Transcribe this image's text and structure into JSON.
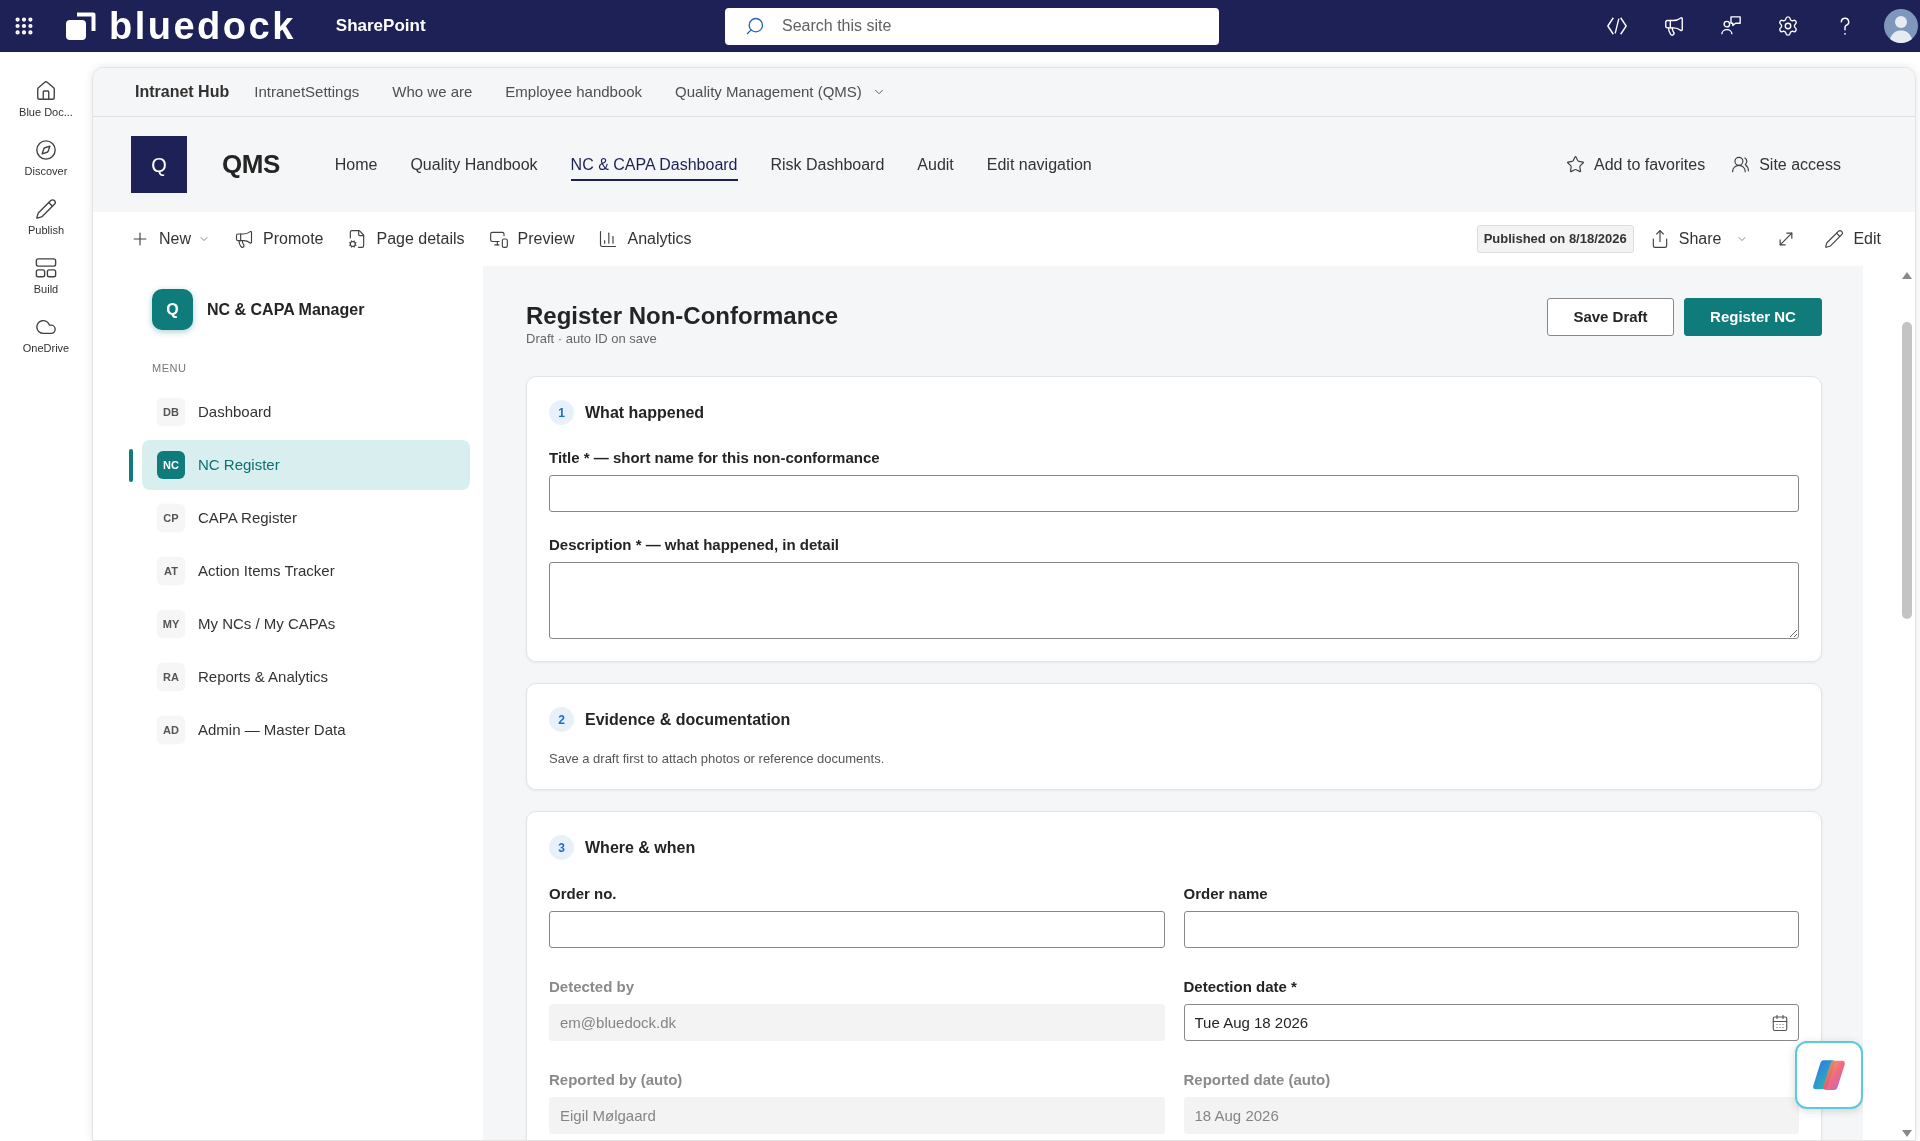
{
  "suite_bar": {
    "brand": "bluedock",
    "app": "SharePoint",
    "search": {
      "placeholder": "Search this site"
    }
  },
  "app_rail": [
    {
      "label": "Blue Doc..."
    },
    {
      "label": "Discover"
    },
    {
      "label": "Publish"
    },
    {
      "label": "Build"
    },
    {
      "label": "OneDrive"
    }
  ],
  "hub_nav": {
    "title": "Intranet Hub",
    "items": [
      {
        "label": "IntranetSettings",
        "dropdown": false
      },
      {
        "label": "Who we are",
        "dropdown": false
      },
      {
        "label": "Employee handbook",
        "dropdown": false
      },
      {
        "label": "Quality Management (QMS)",
        "dropdown": true
      }
    ]
  },
  "site_header": {
    "logo": "Q",
    "title": "QMS",
    "nav": [
      {
        "label": "Home",
        "selected": false
      },
      {
        "label": "Quality Handbook",
        "selected": false
      },
      {
        "label": "NC & CAPA Dashboard",
        "selected": true
      },
      {
        "label": "Risk Dashboard",
        "selected": false
      },
      {
        "label": "Audit",
        "selected": false
      },
      {
        "label": "Edit navigation",
        "selected": false
      }
    ],
    "actions": [
      {
        "label": "Add to favorites"
      },
      {
        "label": "Site access"
      }
    ]
  },
  "command_bar": {
    "actions": [
      {
        "label": "New",
        "dropdown": true
      },
      {
        "label": "Promote",
        "dropdown": false
      },
      {
        "label": "Page details",
        "dropdown": false
      },
      {
        "label": "Preview",
        "dropdown": false
      },
      {
        "label": "Analytics",
        "dropdown": false
      }
    ],
    "status": "Published on 8/18/2026",
    "right_actions": [
      {
        "label": "Share",
        "dropdown": true
      },
      {
        "label": "Edit",
        "dropdown": false
      }
    ]
  },
  "sidebar": {
    "logo": "Q",
    "title": "NC & CAPA Manager",
    "section": "MENU",
    "items": [
      {
        "badge": "DB",
        "label": "Dashboard",
        "selected": false
      },
      {
        "badge": "NC",
        "label": "NC Register",
        "selected": true
      },
      {
        "badge": "CP",
        "label": "CAPA Register",
        "selected": false
      },
      {
        "badge": "AT",
        "label": "Action Items Tracker",
        "selected": false
      },
      {
        "badge": "MY",
        "label": "My NCs / My CAPAs",
        "selected": false
      },
      {
        "badge": "RA",
        "label": "Reports & Analytics",
        "selected": false
      },
      {
        "badge": "AD",
        "label": "Admin — Master Data",
        "selected": false
      }
    ]
  },
  "form": {
    "title": "Register Non-Conformance",
    "subtitle": "Draft · auto ID on save",
    "buttons": [
      {
        "label": "Save Draft",
        "kind": "secondary"
      },
      {
        "label": "Register NC",
        "kind": "primary"
      }
    ],
    "sections": [
      {
        "number": "1",
        "title": "What happened",
        "kind": "stack",
        "fields": [
          {
            "kind": "text",
            "label": "Title * — short name for this non-conformance",
            "disabled": false
          },
          {
            "kind": "textarea",
            "label": "Description * — what happened, in detail",
            "disabled": false
          }
        ]
      },
      {
        "number": "2",
        "title": "Evidence & documentation",
        "kind": "note",
        "note": "Save a draft first to attach photos or reference documents."
      },
      {
        "number": "3",
        "title": "Where & when",
        "kind": "grid",
        "fields": [
          {
            "kind": "text",
            "label": "Order no.",
            "disabled": false
          },
          {
            "kind": "text",
            "label": "Order name",
            "disabled": false
          },
          {
            "kind": "text",
            "label": "Detected by",
            "value": "em@bluedock.dk",
            "disabled": true
          },
          {
            "kind": "date",
            "label": "Detection date *",
            "value": "Tue Aug 18 2026",
            "disabled": false
          },
          {
            "kind": "text",
            "label": "Reported by (auto)",
            "value": "Eigil Mølgaard",
            "disabled": true
          },
          {
            "kind": "text",
            "label": "Reported date (auto)",
            "value": "18 Aug 2026",
            "disabled": true
          }
        ]
      }
    ]
  }
}
